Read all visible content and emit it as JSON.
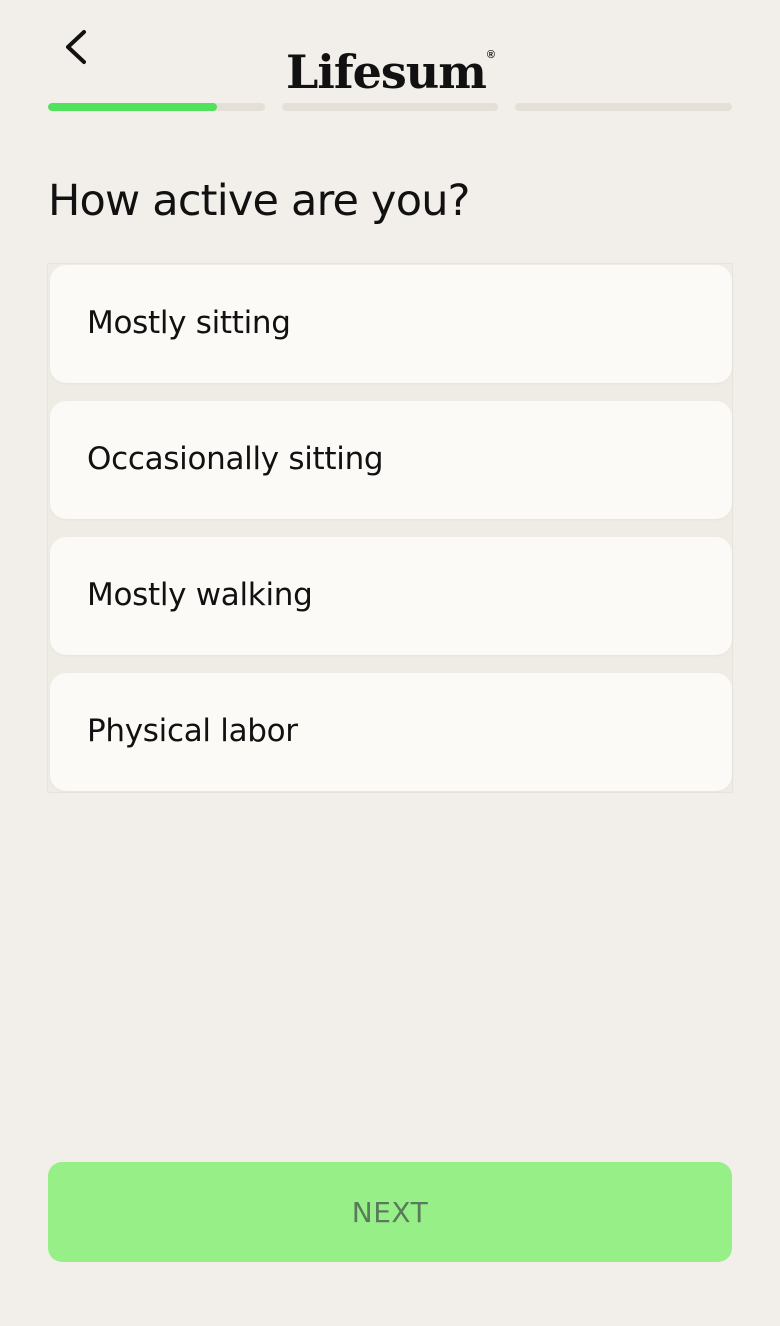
{
  "header": {
    "logo_text": "Lifesum",
    "logo_mark": "®",
    "back_icon": "chevron-left-icon"
  },
  "progress": {
    "steps": 3,
    "current_step": 1,
    "current_step_fraction": 0.78,
    "active_color": "#4fe25a",
    "inactive_color": "#e5e0d7"
  },
  "question": {
    "title": "How active are you?"
  },
  "options": [
    {
      "label": "Mostly sitting"
    },
    {
      "label": "Occasionally sitting"
    },
    {
      "label": "Mostly walking"
    },
    {
      "label": "Physical labor"
    }
  ],
  "footer": {
    "next_label": "NEXT",
    "next_color": "#96f087"
  }
}
